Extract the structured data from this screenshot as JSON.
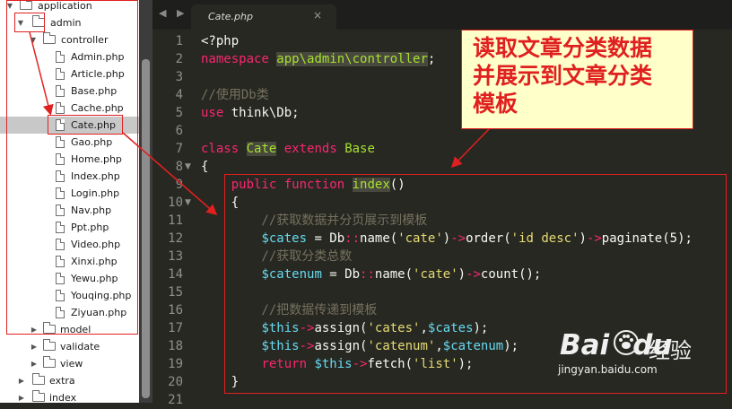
{
  "sidebar": {
    "items": [
      {
        "label": "application",
        "kind": "folder",
        "expanded": true
      },
      {
        "label": "admin",
        "kind": "folder",
        "expanded": true
      },
      {
        "label": "controller",
        "kind": "folder",
        "expanded": true
      },
      {
        "label": "Admin.php",
        "kind": "file"
      },
      {
        "label": "Article.php",
        "kind": "file"
      },
      {
        "label": "Base.php",
        "kind": "file"
      },
      {
        "label": "Cache.php",
        "kind": "file"
      },
      {
        "label": "Cate.php",
        "kind": "file",
        "selected": true
      },
      {
        "label": "Gao.php",
        "kind": "file"
      },
      {
        "label": "Home.php",
        "kind": "file"
      },
      {
        "label": "Index.php",
        "kind": "file"
      },
      {
        "label": "Login.php",
        "kind": "file"
      },
      {
        "label": "Nav.php",
        "kind": "file"
      },
      {
        "label": "Ppt.php",
        "kind": "file"
      },
      {
        "label": "Video.php",
        "kind": "file"
      },
      {
        "label": "Xinxi.php",
        "kind": "file"
      },
      {
        "label": "Yewu.php",
        "kind": "file"
      },
      {
        "label": "Youqing.php",
        "kind": "file"
      },
      {
        "label": "Ziyuan.php",
        "kind": "file"
      },
      {
        "label": "model",
        "kind": "folder",
        "expanded": false
      },
      {
        "label": "validate",
        "kind": "folder",
        "expanded": false
      },
      {
        "label": "view",
        "kind": "folder",
        "expanded": false
      },
      {
        "label": "extra",
        "kind": "folder",
        "expanded": false
      },
      {
        "label": "index",
        "kind": "folder",
        "expanded": false
      }
    ]
  },
  "editor": {
    "tab_title": "Cate.php",
    "nav_arrows": "◀ ▶",
    "close_glyph": "×",
    "line_numbers": [
      "1",
      "2",
      "3",
      "4",
      "5",
      "6",
      "7",
      "8",
      "9",
      "10",
      "11",
      "12",
      "13",
      "14",
      "15",
      "16",
      "17",
      "18",
      "19",
      "20",
      "21"
    ],
    "fold_markers": {
      "8": "▼",
      "10": "▼"
    },
    "lines": [
      "<?php",
      "namespace app\\admin\\controller;",
      "",
      "//使用Db类",
      "use think\\Db;",
      "",
      "class Cate extends Base",
      "{",
      "    public function index()",
      "    {",
      "        //获取数据并分页展示到模板",
      "        $cates = Db::name('cate')->order('id desc')->paginate(5);",
      "        //获取分类总数",
      "        $catenum = Db::name('cate')->count();",
      "",
      "        //把数据传递到模板",
      "        $this->assign('cates',$cates);",
      "        $this->assign('catenum',$catenum);",
      "        return $this->fetch('list');",
      "    }",
      ""
    ]
  },
  "annotation": {
    "callout_lines": [
      "读取文章分类数据",
      "并展示到文章分类",
      "模板"
    ],
    "color": "#e02020"
  },
  "watermark": {
    "brand": "Bai",
    "brand_suffix": "du",
    "cn": "经验",
    "url": "jingyan.baidu.com"
  },
  "colors": {
    "editor_bg": "#272822",
    "keyword": "#f92672",
    "class_name": "#a6e22e",
    "function": "#66d9ef",
    "string": "#e6db74",
    "comment": "#75715e"
  }
}
